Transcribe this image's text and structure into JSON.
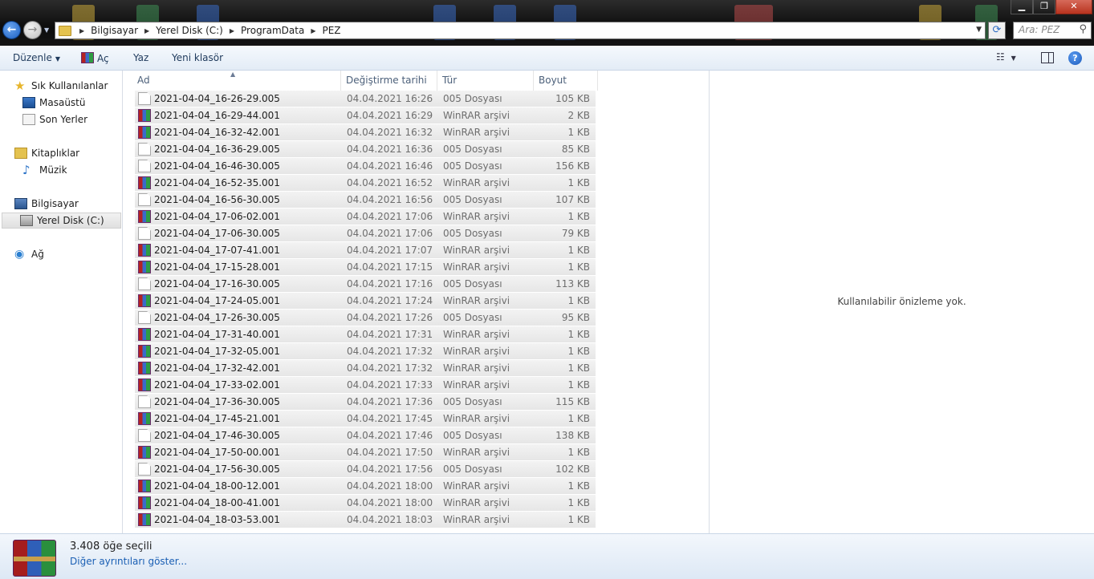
{
  "address": {
    "crumbs": [
      "Bilgisayar",
      "Yerel Disk (C:)",
      "ProgramData",
      "PEZ"
    ],
    "search_placeholder": "Ara: PEZ"
  },
  "toolbar": {
    "organize": "Düzenle",
    "open": "Aç",
    "print": "Yaz",
    "new_folder": "Yeni klasör"
  },
  "sidebar": {
    "favorites": "Sık Kullanılanlar",
    "desktop": "Masaüstü",
    "recent": "Son Yerler",
    "libraries": "Kitaplıklar",
    "music": "Müzik",
    "computer": "Bilgisayar",
    "local_disk": "Yerel Disk (C:)",
    "network": "Ağ"
  },
  "columns": {
    "name": "Ad",
    "date": "Değiştirme tarihi",
    "type": "Tür",
    "size": "Boyut"
  },
  "files": [
    {
      "name": "2021-04-04_16-26-29.005",
      "date": "04.04.2021 16:26",
      "type": "005 Dosyası",
      "size": "105 KB",
      "icon": "generic"
    },
    {
      "name": "2021-04-04_16-29-44.001",
      "date": "04.04.2021 16:29",
      "type": "WinRAR arşivi",
      "size": "2 KB",
      "icon": "rar"
    },
    {
      "name": "2021-04-04_16-32-42.001",
      "date": "04.04.2021 16:32",
      "type": "WinRAR arşivi",
      "size": "1 KB",
      "icon": "rar"
    },
    {
      "name": "2021-04-04_16-36-29.005",
      "date": "04.04.2021 16:36",
      "type": "005 Dosyası",
      "size": "85 KB",
      "icon": "generic"
    },
    {
      "name": "2021-04-04_16-46-30.005",
      "date": "04.04.2021 16:46",
      "type": "005 Dosyası",
      "size": "156 KB",
      "icon": "generic"
    },
    {
      "name": "2021-04-04_16-52-35.001",
      "date": "04.04.2021 16:52",
      "type": "WinRAR arşivi",
      "size": "1 KB",
      "icon": "rar"
    },
    {
      "name": "2021-04-04_16-56-30.005",
      "date": "04.04.2021 16:56",
      "type": "005 Dosyası",
      "size": "107 KB",
      "icon": "generic"
    },
    {
      "name": "2021-04-04_17-06-02.001",
      "date": "04.04.2021 17:06",
      "type": "WinRAR arşivi",
      "size": "1 KB",
      "icon": "rar"
    },
    {
      "name": "2021-04-04_17-06-30.005",
      "date": "04.04.2021 17:06",
      "type": "005 Dosyası",
      "size": "79 KB",
      "icon": "generic"
    },
    {
      "name": "2021-04-04_17-07-41.001",
      "date": "04.04.2021 17:07",
      "type": "WinRAR arşivi",
      "size": "1 KB",
      "icon": "rar"
    },
    {
      "name": "2021-04-04_17-15-28.001",
      "date": "04.04.2021 17:15",
      "type": "WinRAR arşivi",
      "size": "1 KB",
      "icon": "rar"
    },
    {
      "name": "2021-04-04_17-16-30.005",
      "date": "04.04.2021 17:16",
      "type": "005 Dosyası",
      "size": "113 KB",
      "icon": "generic"
    },
    {
      "name": "2021-04-04_17-24-05.001",
      "date": "04.04.2021 17:24",
      "type": "WinRAR arşivi",
      "size": "1 KB",
      "icon": "rar"
    },
    {
      "name": "2021-04-04_17-26-30.005",
      "date": "04.04.2021 17:26",
      "type": "005 Dosyası",
      "size": "95 KB",
      "icon": "generic"
    },
    {
      "name": "2021-04-04_17-31-40.001",
      "date": "04.04.2021 17:31",
      "type": "WinRAR arşivi",
      "size": "1 KB",
      "icon": "rar"
    },
    {
      "name": "2021-04-04_17-32-05.001",
      "date": "04.04.2021 17:32",
      "type": "WinRAR arşivi",
      "size": "1 KB",
      "icon": "rar"
    },
    {
      "name": "2021-04-04_17-32-42.001",
      "date": "04.04.2021 17:32",
      "type": "WinRAR arşivi",
      "size": "1 KB",
      "icon": "rar"
    },
    {
      "name": "2021-04-04_17-33-02.001",
      "date": "04.04.2021 17:33",
      "type": "WinRAR arşivi",
      "size": "1 KB",
      "icon": "rar"
    },
    {
      "name": "2021-04-04_17-36-30.005",
      "date": "04.04.2021 17:36",
      "type": "005 Dosyası",
      "size": "115 KB",
      "icon": "generic"
    },
    {
      "name": "2021-04-04_17-45-21.001",
      "date": "04.04.2021 17:45",
      "type": "WinRAR arşivi",
      "size": "1 KB",
      "icon": "rar"
    },
    {
      "name": "2021-04-04_17-46-30.005",
      "date": "04.04.2021 17:46",
      "type": "005 Dosyası",
      "size": "138 KB",
      "icon": "generic"
    },
    {
      "name": "2021-04-04_17-50-00.001",
      "date": "04.04.2021 17:50",
      "type": "WinRAR arşivi",
      "size": "1 KB",
      "icon": "rar"
    },
    {
      "name": "2021-04-04_17-56-30.005",
      "date": "04.04.2021 17:56",
      "type": "005 Dosyası",
      "size": "102 KB",
      "icon": "generic"
    },
    {
      "name": "2021-04-04_18-00-12.001",
      "date": "04.04.2021 18:00",
      "type": "WinRAR arşivi",
      "size": "1 KB",
      "icon": "rar"
    },
    {
      "name": "2021-04-04_18-00-41.001",
      "date": "04.04.2021 18:00",
      "type": "WinRAR arşivi",
      "size": "1 KB",
      "icon": "rar"
    },
    {
      "name": "2021-04-04_18-03-53.001",
      "date": "04.04.2021 18:03",
      "type": "WinRAR arşivi",
      "size": "1 KB",
      "icon": "rar"
    }
  ],
  "preview": {
    "message": "Kullanılabilir önizleme yok."
  },
  "details": {
    "count": "3.408 öğe seçili",
    "link": "Diğer ayrıntıları göster..."
  }
}
